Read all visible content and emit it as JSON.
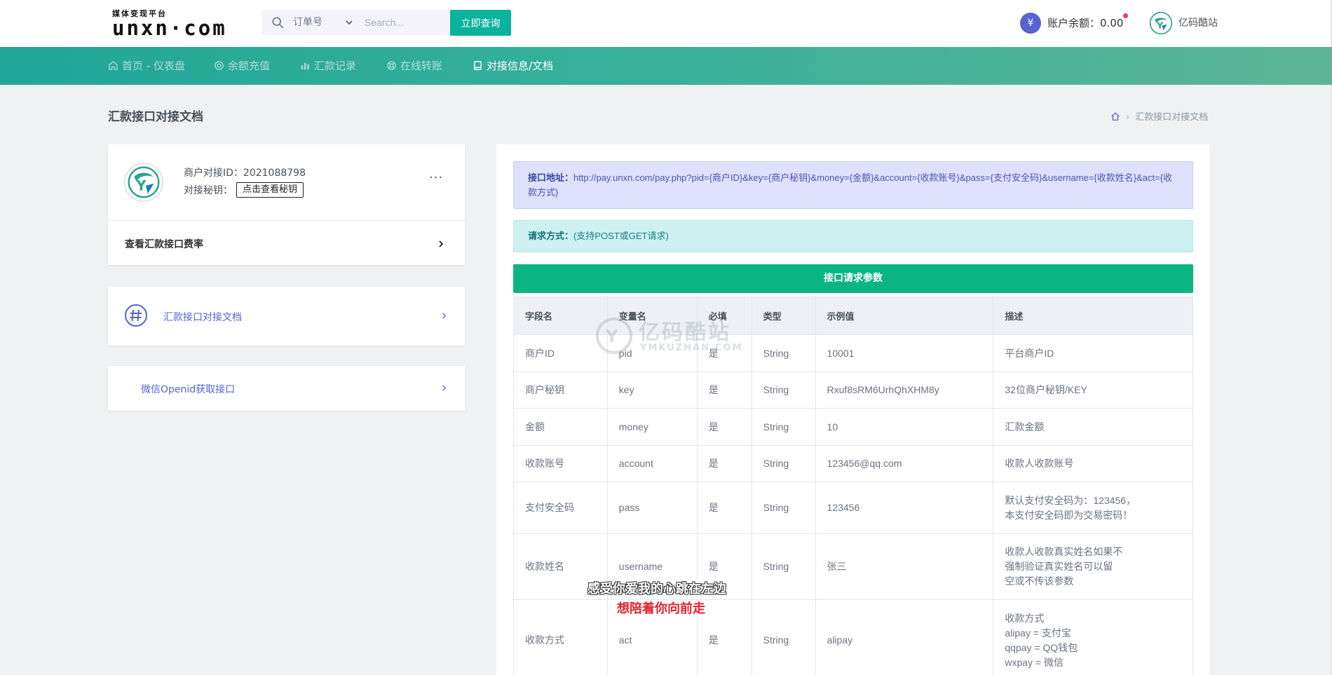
{
  "header": {
    "logo_sub": "媒体变现平台",
    "logo_main": "unxn·com",
    "search_select": "订单号",
    "search_placeholder": "Search...",
    "query_button": "立即查询",
    "balance_symbol": "¥",
    "balance_label": "账户余额：",
    "balance_value": "0.00",
    "user_name": "亿码酷站"
  },
  "nav": {
    "items": [
      {
        "label": "首页 - 仪表盘",
        "icon": "home-icon"
      },
      {
        "label": "余额充值",
        "icon": "target-icon"
      },
      {
        "label": "汇款记录",
        "icon": "bar-chart-icon"
      },
      {
        "label": "在线转账",
        "icon": "lifebuoy-icon"
      },
      {
        "label": "对接信息/文档",
        "icon": "book-icon",
        "active": true
      }
    ]
  },
  "page": {
    "title": "汇款接口对接文档",
    "breadcrumb": "汇款接口对接文档"
  },
  "merchant_card": {
    "id_label": "商户对接ID：",
    "id_value": "2021088798",
    "key_label": "对接秘钥：",
    "view_key_button": "点击查看秘钥",
    "more": "···",
    "rate_link": "查看汇款接口费率"
  },
  "side_links": {
    "doc_link": "汇款接口对接文档",
    "openid_link": "微信Openid获取接口"
  },
  "api_doc": {
    "url_label": "接口地址：",
    "url_value": "http://pay.unxn.com/pay.php?pid={商户ID}&key={商户秘钥}&money={金额}&account={收款账号}&pass={支付安全码}&username={收款姓名}&act={收款方式}",
    "method_label": "请求方式：",
    "method_value": "(支持POST或GET请求)",
    "params_title": "接口请求参数",
    "columns": [
      "字段名",
      "变量名",
      "必填",
      "类型",
      "示例值",
      "描述"
    ],
    "rows": [
      {
        "field": "商户ID",
        "var": "pid",
        "required": "是",
        "type": "String",
        "example": "10001",
        "desc": "平台商户ID"
      },
      {
        "field": "商户秘钥",
        "var": "key",
        "required": "是",
        "type": "String",
        "example": "Rxuf8sRM6UrhQhXHM8y",
        "desc": "32位商户秘钥/KEY"
      },
      {
        "field": "金额",
        "var": "money",
        "required": "是",
        "type": "String",
        "example": "10",
        "desc": "汇款金额"
      },
      {
        "field": "收款账号",
        "var": "account",
        "required": "是",
        "type": "String",
        "example": "123456@qq.com",
        "desc": "收款人收款账号"
      },
      {
        "field": "支付安全码",
        "var": "pass",
        "required": "是",
        "type": "String",
        "example": "123456",
        "desc": "默认支付安全码为：123456，\n本支付安全码即为交易密码！"
      },
      {
        "field": "收款姓名",
        "var": "username",
        "required": "是",
        "type": "String",
        "example": "张三",
        "desc": "收款人收款真实姓名如果不\n强制验证真实姓名可以留\n空或不传该参数"
      },
      {
        "field": "收款方式",
        "var": "act",
        "required": "是",
        "type": "String",
        "example": "alipay",
        "desc": "收款方式\nalipay = 支付宝\nqqpay = QQ钱包\nwxpay = 微信"
      }
    ]
  },
  "overlay": {
    "watermark_cn": "亿码酷站",
    "watermark_en": "YMKUZHAN.COM",
    "subtitle_line1": "感受你爱我的心跳在左边",
    "subtitle_line2": "想陪着你向前走"
  },
  "colors": {
    "accent_green": "#0ab39c",
    "nav_gradient_start": "#21a597",
    "link_blue": "#5664d2",
    "params_bar": "#0ab582"
  }
}
